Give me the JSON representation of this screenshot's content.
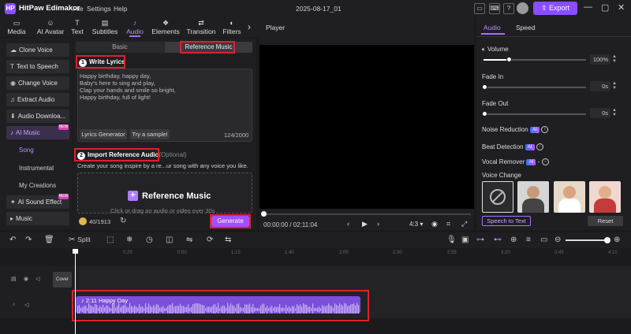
{
  "app": {
    "name": "HitPaw Edimakor",
    "menu": [
      "File",
      "Settings",
      "Help"
    ],
    "doc_title": "2025-08-17_01",
    "export_label": "Export",
    "logo_text": "HP"
  },
  "tabs": [
    {
      "label": "Media",
      "icon": "▭"
    },
    {
      "label": "AI Avatar",
      "icon": "☺"
    },
    {
      "label": "Text",
      "icon": "T"
    },
    {
      "label": "Subtitles",
      "icon": "▤"
    },
    {
      "label": "Audio",
      "icon": "♪"
    },
    {
      "label": "Elements",
      "icon": "❖"
    },
    {
      "label": "Transition",
      "icon": "⇄"
    },
    {
      "label": "Filters",
      "icon": "◐"
    }
  ],
  "sidebar": {
    "items": [
      {
        "label": "Clone Voice",
        "icon": "☁"
      },
      {
        "label": "Text to Speech",
        "icon": "T"
      },
      {
        "label": "Change Voice",
        "icon": "◉"
      },
      {
        "label": "Extract Audio",
        "icon": "♫"
      },
      {
        "label": "Audio Downloa...",
        "icon": "⬇"
      },
      {
        "label": "AI Music",
        "icon": "♪",
        "badge": "NEW"
      }
    ],
    "subitems": [
      "Song",
      "Instrumental",
      "My Creations"
    ],
    "more": [
      {
        "label": "AI Sound Effect",
        "icon": "✦",
        "badge": "NEW"
      },
      {
        "label": "Music",
        "icon": "▸"
      }
    ]
  },
  "panel": {
    "seg_basic": "Basic",
    "seg_reference": "Reference Music",
    "write_lyrics": {
      "num": "1",
      "title": "Write Lyrics"
    },
    "lyrics": [
      "Happy birthday, happy day,",
      "Baby’s here to sing and play,",
      "Clap your hands and smile so bright,",
      "Happy birthday, full of light!"
    ],
    "lyrics_generator": "Lyrics Generator",
    "try_sample": "Try a sample!",
    "char_count": "124/2000",
    "import_ref": {
      "num": "2",
      "title": "Import Reference Audio",
      "optional": "(Optional)"
    },
    "description": "Create your song inspire by a re...ur song with any voice you like.",
    "upload_title": "Reference Music",
    "upload_hint": "Click or drag an audio or video over 30s",
    "credits": "40/1913",
    "generate": "Generate"
  },
  "player": {
    "label": "Player",
    "time": "00:00:00 / 02:11:04",
    "ratio": "4:3 ▾"
  },
  "right": {
    "tabs": [
      "Audio",
      "Speed"
    ],
    "volume": {
      "label": "Volume",
      "value": "100%",
      "level": 1.0
    },
    "fade_in": {
      "label": "Fade In",
      "value": "0s"
    },
    "fade_out": {
      "label": "Fade Out",
      "value": "0s"
    },
    "noise": "Noise Reduction",
    "beat": "Beat Detection",
    "vocal": "Vocal Remover",
    "voice_change": "Voice Change",
    "ai_badge": "AI",
    "speech_to_text": "Speech to Text",
    "reset": "Reset"
  },
  "toolbar": {
    "split": "Split"
  },
  "timeline": {
    "ticks": [
      "0:25",
      "0:50",
      "1:15",
      "1:40",
      "2:05",
      "2:30",
      "2:55",
      "3:20",
      "3:45",
      "4:10"
    ],
    "cover": "Cover",
    "clip_label": "2:11 Happy Day"
  }
}
